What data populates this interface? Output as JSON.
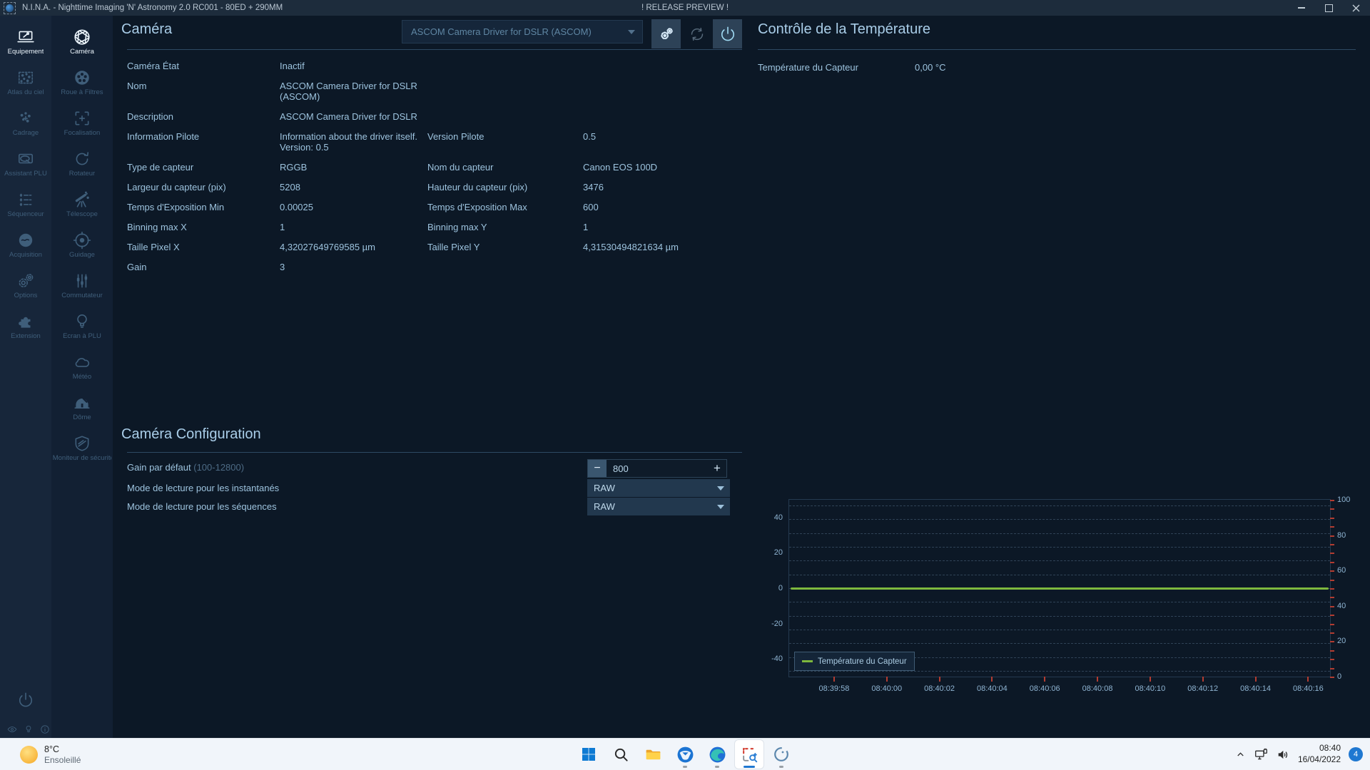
{
  "title_bar": {
    "title": "N.I.N.A. - Nighttime Imaging 'N' Astronomy 2.0 RC001  -  80ED + 290MM",
    "release_banner": "! RELEASE PREVIEW !"
  },
  "sidebar": {
    "items": [
      {
        "label": "Équipement",
        "icon": "laptop-plug-icon",
        "active": true
      },
      {
        "label": "Atlas du ciel",
        "icon": "sky-atlas-icon",
        "active": false
      },
      {
        "label": "Cadrage",
        "icon": "framing-icon",
        "active": false
      },
      {
        "label": "Assistant PLU",
        "icon": "flat-wizard-icon",
        "active": false
      },
      {
        "label": "Séquenceur",
        "icon": "sequencer-icon",
        "active": false
      },
      {
        "label": "Acquisition",
        "icon": "imaging-icon",
        "active": false
      },
      {
        "label": "Options",
        "icon": "gears-icon",
        "active": false
      },
      {
        "label": "Extension",
        "icon": "puzzle-icon",
        "active": false
      }
    ]
  },
  "equipment_nav": {
    "items": [
      {
        "label": "Caméra",
        "icon": "aperture-icon",
        "active": true
      },
      {
        "label": "Roue à Filtres",
        "icon": "filter-wheel-icon",
        "active": false
      },
      {
        "label": "Focalisation",
        "icon": "focuser-icon",
        "active": false
      },
      {
        "label": "Rotateur",
        "icon": "rotator-icon",
        "active": false
      },
      {
        "label": "Télescope",
        "icon": "telescope-icon",
        "active": false
      },
      {
        "label": "Guidage",
        "icon": "guider-icon",
        "active": false
      },
      {
        "label": "Commutateur",
        "icon": "switch-icon",
        "active": false
      },
      {
        "label": "Écran à PLU",
        "icon": "flat-panel-icon",
        "active": false
      },
      {
        "label": "Météo",
        "icon": "weather-icon",
        "active": false
      },
      {
        "label": "Dôme",
        "icon": "dome-icon",
        "active": false
      },
      {
        "label": "Moniteur de sécurité",
        "icon": "shield-icon",
        "active": false
      }
    ]
  },
  "camera_panel": {
    "title": "Caméra",
    "device_selector": "ASCOM Camera Driver for DSLR (ASCOM)",
    "rows": [
      {
        "l1": "Caméra État",
        "v1": "Inactif",
        "l2": "",
        "v2": ""
      },
      {
        "l1": "Nom",
        "v1": "ASCOM Camera Driver for DSLR (ASCOM)",
        "l2": "",
        "v2": ""
      },
      {
        "l1": "Description",
        "v1": "ASCOM Camera Driver for DSLR",
        "l2": "",
        "v2": ""
      },
      {
        "l1": "Information Pilote",
        "v1": "Information about the driver itself.\nVersion: 0.5",
        "l2": "Version Pilote",
        "v2": "0.5"
      },
      {
        "l1": "Type de capteur",
        "v1": "RGGB",
        "l2": "Nom du capteur",
        "v2": "Canon EOS 100D"
      },
      {
        "l1": "Largeur du capteur (pix)",
        "v1": "5208",
        "l2": "Hauteur du capteur (pix)",
        "v2": "3476"
      },
      {
        "l1": "Temps d'Exposition Min",
        "v1": "0.00025",
        "l2": "Temps d'Exposition Max",
        "v2": "600"
      },
      {
        "l1": "Binning max X",
        "v1": "1",
        "l2": "Binning max Y",
        "v2": "1"
      },
      {
        "l1": "Taille Pixel X",
        "v1": "4,32027649769585 µm",
        "l2": "Taille Pixel Y",
        "v2": "4,31530494821634 µm"
      },
      {
        "l1": "Gain",
        "v1": "3",
        "l2": "",
        "v2": ""
      }
    ]
  },
  "temperature_panel": {
    "title": "Contrôle de la Température",
    "sensor_label": "Température du Capteur",
    "sensor_value": "0,00 °C"
  },
  "camera_config": {
    "title": "Caméra Configuration",
    "gain_label": "Gain par défaut",
    "gain_range": "(100-12800)",
    "gain_value": "800",
    "snapshot_label": "Mode de lecture pour les instantanés",
    "snapshot_value": "RAW",
    "sequence_label": "Mode de lecture pour les séquences",
    "sequence_value": "RAW"
  },
  "chart_data": {
    "type": "line",
    "x_labels": [
      "08:39:58",
      "08:40:00",
      "08:40:02",
      "08:40:04",
      "08:40:06",
      "08:40:08",
      "08:40:10",
      "08:40:12",
      "08:40:14",
      "08:40:16"
    ],
    "left_axis": {
      "ticks": [
        40,
        20,
        0,
        -20,
        -40
      ],
      "range": [
        -50,
        50
      ]
    },
    "right_axis": {
      "ticks": [
        100,
        80,
        60,
        40,
        20,
        0
      ],
      "range": [
        0,
        100
      ]
    },
    "series": [
      {
        "name": "Température du Capteur",
        "color": "#7eb83e",
        "values": [
          0,
          0,
          0,
          0,
          0,
          0,
          0,
          0,
          0,
          0
        ],
        "axis": "left"
      }
    ],
    "legend": {
      "label": "Température du Capteur",
      "position": "bottom-left"
    },
    "grid": true
  },
  "taskbar": {
    "weather": {
      "temp": "8°C",
      "condition": "Ensoleillé",
      "icon": "sun-icon"
    },
    "center_icons": [
      {
        "icon": "windows-start-icon",
        "running": false,
        "active": false
      },
      {
        "icon": "search-icon",
        "running": false,
        "active": false
      },
      {
        "icon": "file-explorer-icon",
        "running": false,
        "active": false
      },
      {
        "icon": "thunderbird-icon",
        "running": true,
        "active": false
      },
      {
        "icon": "edge-icon",
        "running": true,
        "active": false
      },
      {
        "icon": "screenshot-tool-icon",
        "running": true,
        "active": true
      },
      {
        "icon": "nina-app-icon",
        "running": true,
        "active": false
      }
    ],
    "tray": {
      "time": "08:40",
      "date": "16/04/2022",
      "badge": "4"
    }
  },
  "colors": {
    "accent": "#a9cde8",
    "series_green": "#7eb83e",
    "tick_red": "#b23c31",
    "active_button_bg": "#2d4257"
  }
}
